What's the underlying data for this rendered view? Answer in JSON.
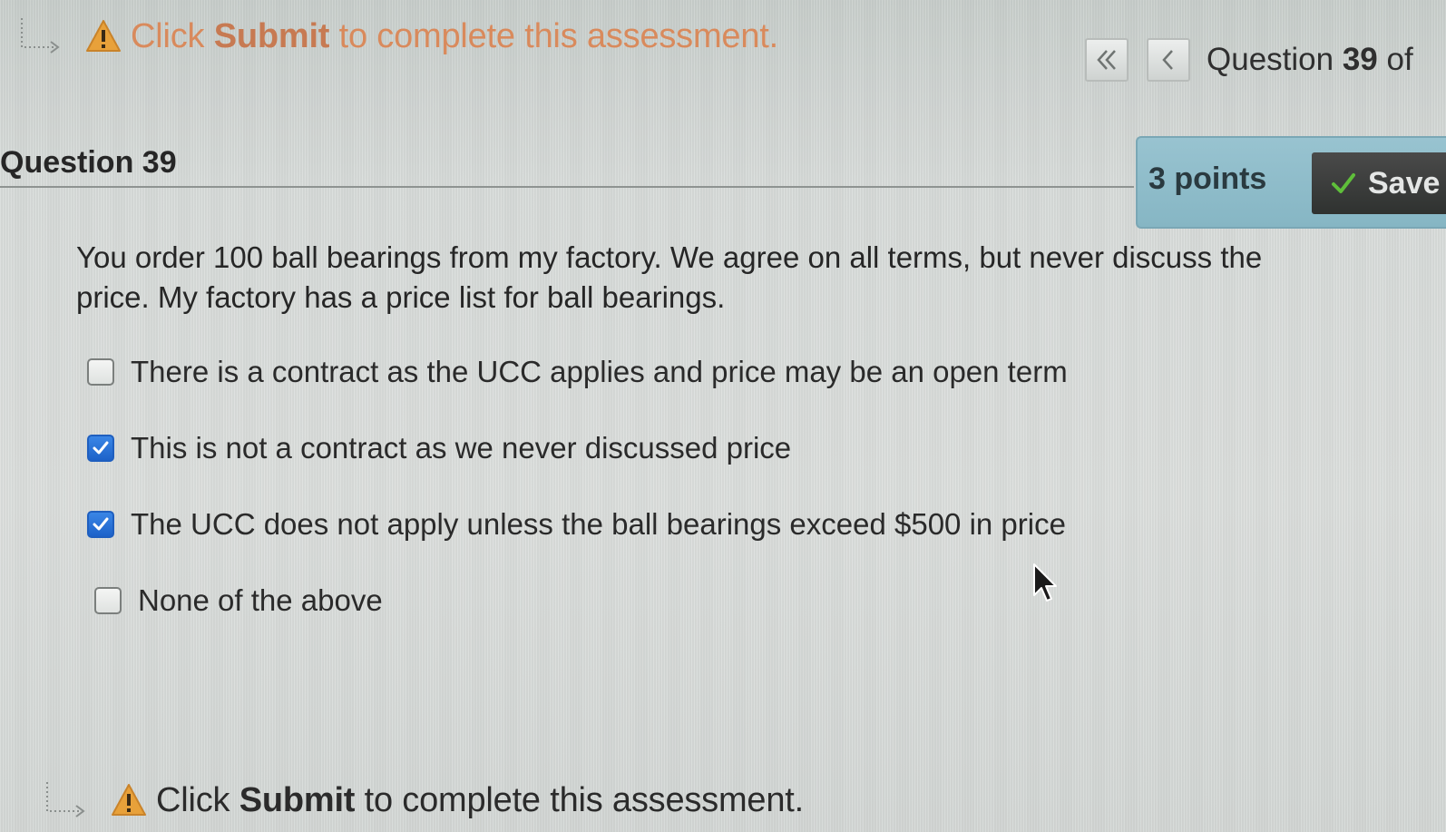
{
  "instruction": {
    "prefix": "Click ",
    "emphasis": "Submit",
    "suffix": " to complete this assessment."
  },
  "navigation": {
    "first_icon": "double-chevron-left-icon",
    "prev_icon": "chevron-left-icon",
    "label_prefix": "Question ",
    "label_number": "39",
    "label_suffix": " of"
  },
  "question": {
    "title": "Question 39",
    "points": "3 points",
    "status": "Save",
    "status_icon": "checkmark-icon",
    "prompt_line1": "You order 100 ball bearings from my factory.  We agree on all terms, but never discuss the",
    "prompt_line2": "price.  My factory has a price list for ball bearings.",
    "answers": [
      {
        "label": "There is a contract as the UCC applies and price may be an open term",
        "checked": false
      },
      {
        "label": "This is not a contract as we never discussed price",
        "checked": true
      },
      {
        "label": "The UCC does not apply unless the ball bearings exceed $500 in price",
        "checked": true
      },
      {
        "label": "None of the above",
        "checked": false
      }
    ]
  },
  "footer_instruction": {
    "prefix": "Click ",
    "emphasis": "Submit",
    "suffix": " to complete this assessment."
  },
  "colors": {
    "warning": "#e8a13a",
    "accent_blue": "#1d62c9",
    "points_bg": "#8fbecb",
    "saved_bg": "#333533",
    "check_green": "#5fbf3a"
  }
}
